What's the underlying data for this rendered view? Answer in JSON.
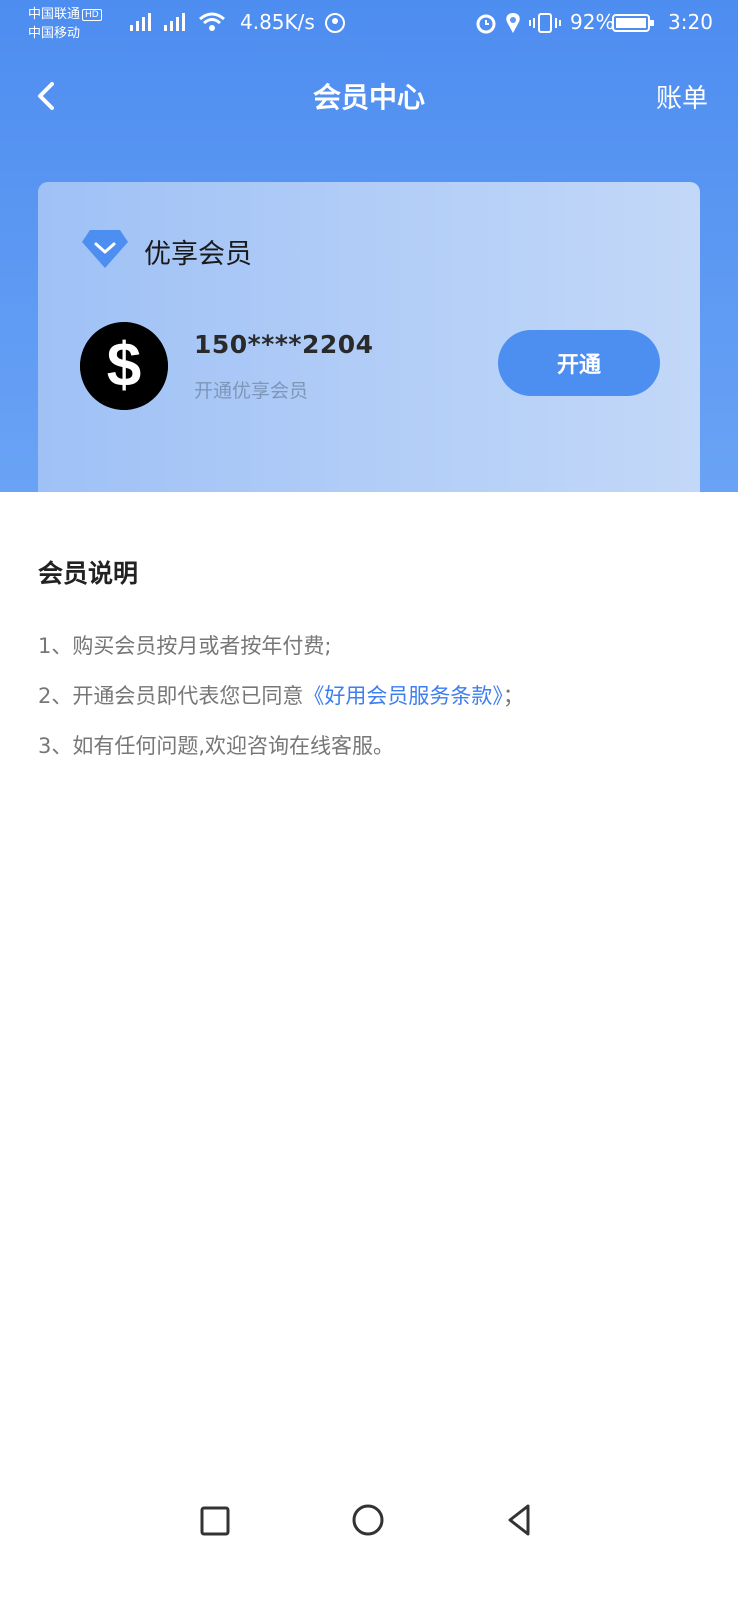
{
  "status_bar": {
    "carrier1": "中国联通",
    "carrier1_badge": "HD",
    "carrier2": "中国移动",
    "net_speed": "4.85K/s",
    "battery_pct": "92%",
    "time": "3:20"
  },
  "header": {
    "title": "会员中心",
    "right_action": "账单"
  },
  "card": {
    "level": "优享会员",
    "phone": "150****2204",
    "subtitle": "开通优享会员",
    "open_button": "开通"
  },
  "description": {
    "title": "会员说明",
    "rules": [
      "1、购买会员按月或者按年付费;",
      "2、开通会员即代表您已同意",
      "3、如有任何问题,欢迎咨询在线客服。"
    ],
    "terms_link": "《好用会员服务条款》",
    "rule2_suffix": "；"
  },
  "colors": {
    "primary": "#4d8ef1",
    "link": "#3d7ef0"
  },
  "icons": [
    "back-arrow-icon",
    "diamond-icon",
    "dollar-avatar-icon",
    "square-nav-icon",
    "circle-nav-icon",
    "triangle-back-icon"
  ]
}
